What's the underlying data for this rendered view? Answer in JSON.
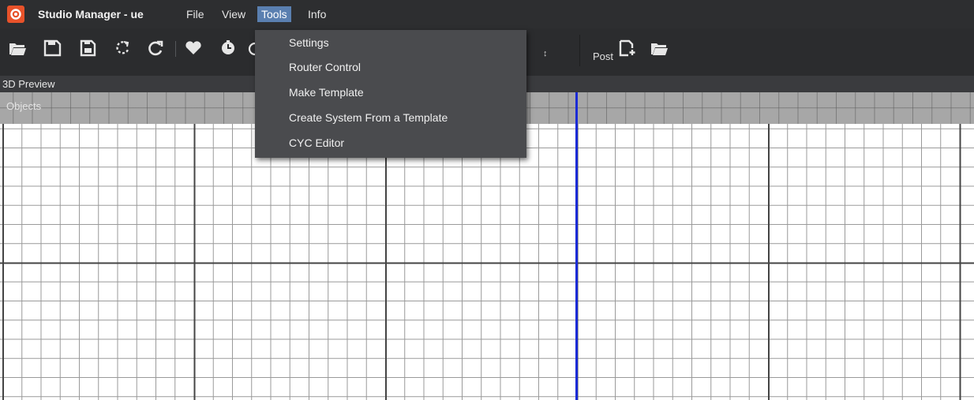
{
  "window": {
    "title": "Studio Manager - ue"
  },
  "menubar": {
    "items": [
      {
        "label": "File",
        "active": false
      },
      {
        "label": "View",
        "active": false
      },
      {
        "label": "Tools",
        "active": true
      },
      {
        "label": "Info",
        "active": false
      }
    ]
  },
  "toolbar": {
    "icons": [
      "open-folder-icon",
      "save-icon",
      "save-all-icon",
      "undo-icon",
      "redo-icon",
      "heart-icon",
      "clock-icon",
      "camera-icon"
    ],
    "spinner_symbol": "↕",
    "post_label": "Post",
    "post_icons": [
      "new-file-icon",
      "open-folder-icon"
    ]
  },
  "panels": {
    "preview_title": "3D Preview",
    "objects_label": "Objects"
  },
  "tools_menu": {
    "items": [
      {
        "label": "Settings"
      },
      {
        "label": "Router Control"
      },
      {
        "label": "Make Template"
      },
      {
        "label": "Create System From a Template"
      },
      {
        "label": "CYC Editor"
      }
    ]
  },
  "colors": {
    "accent": "#e8522a",
    "menu_highlight": "#5a7fb0",
    "axis": "#1a2bd6",
    "titlebar": "#2d2e30"
  }
}
